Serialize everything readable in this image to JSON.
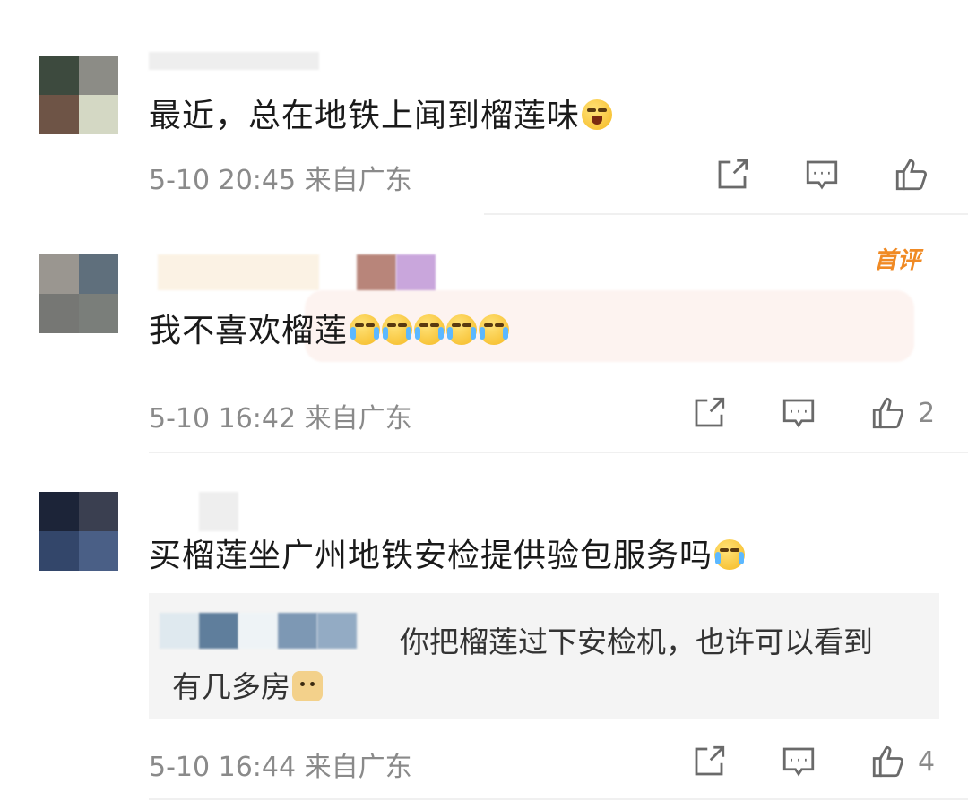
{
  "comments": [
    {
      "text": "最近，总在地铁上闻到榴莲味",
      "meta": "5-10 20:45 来自广东",
      "like_count": ""
    },
    {
      "badge": "首评",
      "text": "我不喜欢榴莲",
      "meta": "5-10 16:42 来自广东",
      "like_count": "2"
    },
    {
      "text": "买榴莲坐广州地铁安检提供验包服务吗",
      "reply_line1": "你把榴莲过下安检机，也许可以看到",
      "reply_line2": "有几多房",
      "meta": "5-10 16:44 来自广东",
      "like_count": "4"
    }
  ],
  "icons": {
    "share": "share-icon",
    "reply": "comment-icon",
    "like": "thumbs-up-icon",
    "emoji_cry": "crying-laughing-emoji",
    "emoji_doge": "doge-emoji"
  },
  "colors": {
    "badge": "#f08a24",
    "meta_text": "#8a8a8a",
    "reply_bg": "#f4f4f4"
  }
}
